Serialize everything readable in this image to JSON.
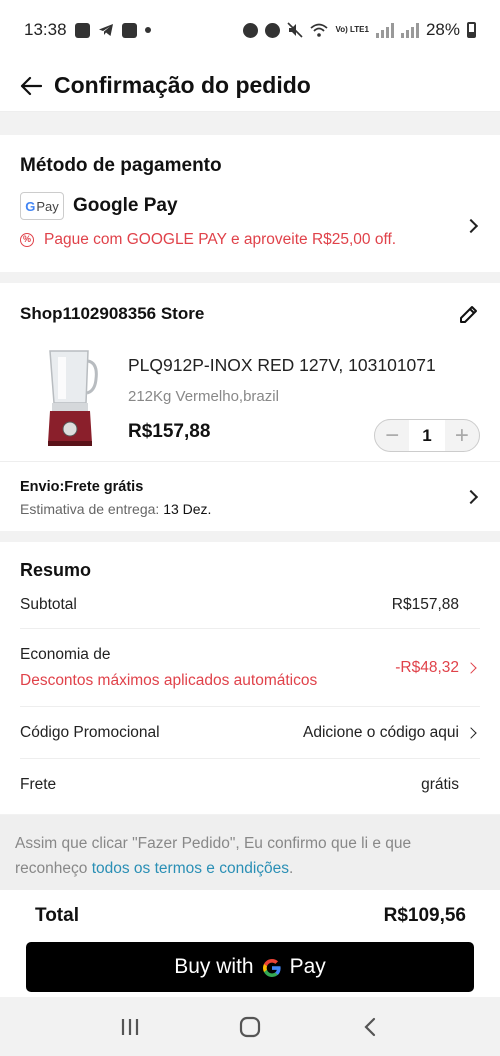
{
  "status_bar": {
    "time": "13:38",
    "network": "Vo) LTE1",
    "battery": "28%"
  },
  "header": {
    "title": "Confirmação do pedido"
  },
  "payment": {
    "section_title": "Método de pagamento",
    "badge_text": "Pay",
    "method_name": "Google Pay",
    "promo_text": "Pague com GOOGLE PAY e aproveite R$25,00 off.",
    "promo_color": "#e0424a"
  },
  "shop": {
    "name": "Shop1102908356 Store",
    "product": {
      "name": "PLQ912P-INOX RED 127V, 103101071",
      "variant": "212Kg Vermelho,brazil",
      "price": "R$157,88",
      "quantity": "1"
    },
    "shipping": {
      "title": "Envio:Frete grátis",
      "estimate_label": "Estimativa de entrega: ",
      "estimate_date": "13 Dez."
    }
  },
  "summary": {
    "title": "Resumo",
    "subtotal_label": "Subtotal",
    "subtotal_value": "R$157,88",
    "savings_label": "Economia de",
    "savings_sublabel": "Descontos máximos aplicados automáticos",
    "savings_value": "-R$48,32",
    "promo_code_label": "Código Promocional",
    "promo_code_value": "Adicione o código aqui",
    "shipping_label": "Frete",
    "shipping_value": "grátis"
  },
  "terms": {
    "text": "Assim que clicar \"Fazer Pedido\", Eu confirmo que li e que reconheço ",
    "link": "todos os termos e condições",
    "suffix": "."
  },
  "footer": {
    "total_label": "Total",
    "total_value": "R$109,56",
    "buy_prefix": "Buy with",
    "buy_suffix": "Pay"
  },
  "colors": {
    "accent_red": "#e0424a",
    "link_blue": "#2a8fb5",
    "button_black": "#000000"
  }
}
